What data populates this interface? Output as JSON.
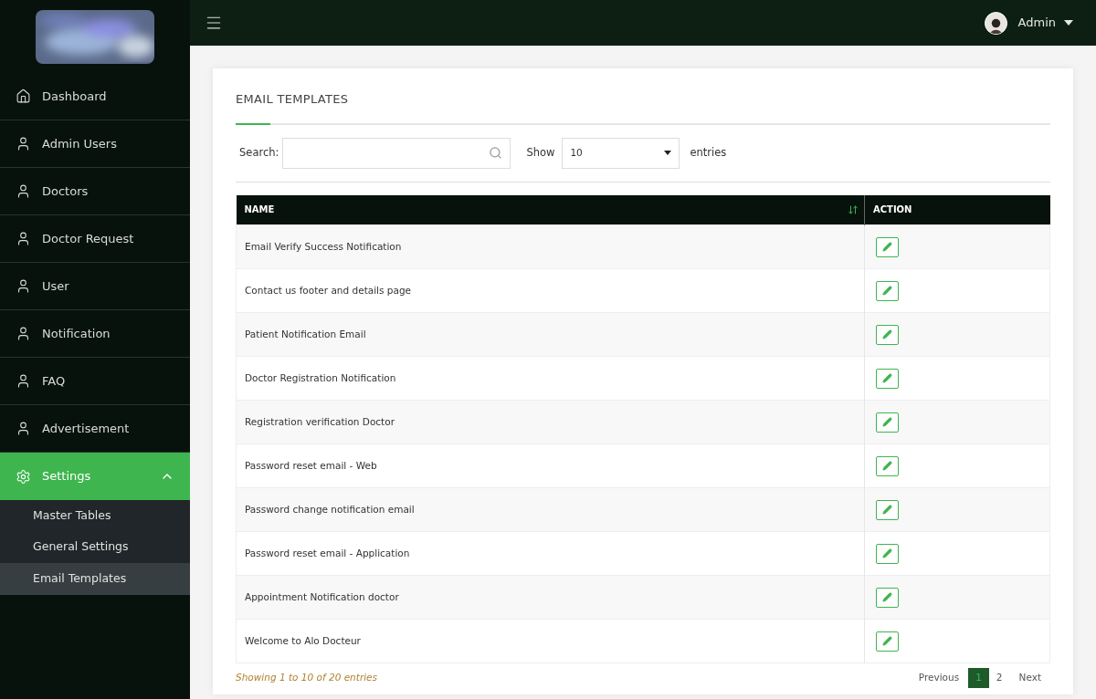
{
  "sidebar": {
    "items": [
      {
        "label": "Dashboard",
        "kind": "home",
        "selected": false
      },
      {
        "label": "Admin Users",
        "kind": "user",
        "selected": false
      },
      {
        "label": "Doctors",
        "kind": "user",
        "selected": false
      },
      {
        "label": "Doctor Request",
        "kind": "user",
        "selected": false
      },
      {
        "label": "User",
        "kind": "user",
        "selected": false
      },
      {
        "label": "Notification",
        "kind": "user",
        "selected": false
      },
      {
        "label": "FAQ",
        "kind": "user",
        "selected": false
      },
      {
        "label": "Advertisement",
        "kind": "user",
        "selected": false
      },
      {
        "label": "Settings",
        "kind": "settings",
        "selected": true,
        "expanded": true,
        "children": [
          {
            "label": "Master Tables",
            "selected": false
          },
          {
            "label": "General Settings",
            "selected": false
          },
          {
            "label": "Email Templates",
            "selected": true
          }
        ]
      }
    ]
  },
  "topbar": {
    "user": "Admin"
  },
  "card": {
    "title": "EMAIL TEMPLATES",
    "search": {
      "label": "Search:"
    },
    "length": {
      "before": "Show",
      "value": "10",
      "after": "entries"
    },
    "table": {
      "columns": [
        "NAME",
        "ACTION"
      ],
      "rows": [
        {
          "name": "Email Verify Success Notification"
        },
        {
          "name": "Contact us footer and details page"
        },
        {
          "name": "Patient Notification Email"
        },
        {
          "name": "Doctor Registration Notification"
        },
        {
          "name": "Registration verification Doctor"
        },
        {
          "name": "Password reset email - Web"
        },
        {
          "name": "Password change notification email"
        },
        {
          "name": "Password reset email - Application"
        },
        {
          "name": "Appointment Notification doctor"
        },
        {
          "name": "Welcome to Alo Docteur"
        }
      ]
    },
    "info": "Showing 1 to 10 of 20 entries",
    "pagination": [
      {
        "label": "Previous",
        "kind": "nav",
        "selected": false
      },
      {
        "label": "1",
        "kind": "page",
        "selected": true
      },
      {
        "label": "2",
        "kind": "page",
        "selected": false
      },
      {
        "label": "Next",
        "kind": "nav",
        "selected": false
      }
    ]
  }
}
